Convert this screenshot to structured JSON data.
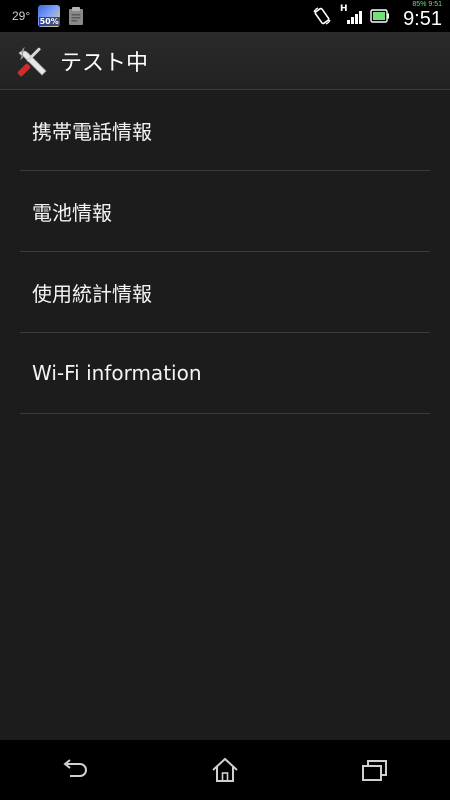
{
  "status_bar": {
    "temperature": "29°",
    "weather_percent": "50%",
    "mini_status": "85% 9:51",
    "signal_type": "H",
    "time": "9:51"
  },
  "action_bar": {
    "title": "テスト中"
  },
  "menu": {
    "items": [
      {
        "label": "携帯電話情報"
      },
      {
        "label": "電池情報"
      },
      {
        "label": "使用統計情報"
      },
      {
        "label": "Wi-Fi information"
      }
    ]
  },
  "icons": {
    "app": "tools-icon",
    "weather": "weather-icon",
    "clipboard": "clipboard-icon",
    "rotate": "rotate-icon",
    "signal": "signal-icon",
    "battery": "battery-icon",
    "back": "back-icon",
    "home": "home-icon",
    "recents": "recent-apps-icon"
  },
  "colors": {
    "background": "#1c1c1c",
    "divider": "#3b3b3b",
    "battery": "#6fe07a",
    "tool_handle": "#d42a2a"
  }
}
